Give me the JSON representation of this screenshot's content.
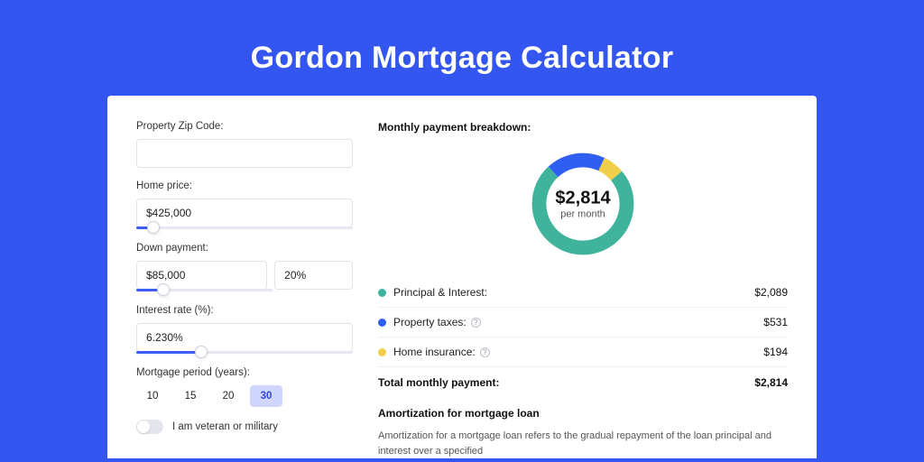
{
  "title": "Gordon Mortgage Calculator",
  "left": {
    "zip_label": "Property Zip Code:",
    "zip_value": "",
    "home_price_label": "Home price:",
    "home_price_value": "$425,000",
    "home_price_slider_pct": 8,
    "down_payment_label": "Down payment:",
    "down_payment_value": "$85,000",
    "down_payment_pct_value": "20%",
    "down_payment_slider_pct": 20,
    "interest_label": "Interest rate (%):",
    "interest_value": "6.230%",
    "interest_slider_pct": 30,
    "period_label": "Mortgage period (years):",
    "period_options": [
      "10",
      "15",
      "20",
      "30"
    ],
    "period_selected": "30",
    "veteran_label": "I am veteran or military",
    "veteran_on": false
  },
  "right": {
    "breakdown_title": "Monthly payment breakdown:",
    "donut_amount": "$2,814",
    "donut_sub": "per month",
    "legend": [
      {
        "label": "Principal & Interest:",
        "value": "$2,089",
        "color": "#3fb39b",
        "info": false
      },
      {
        "label": "Property taxes:",
        "value": "$531",
        "color": "#2f5ff1",
        "info": true
      },
      {
        "label": "Home insurance:",
        "value": "$194",
        "color": "#f2cf4a",
        "info": true
      }
    ],
    "total_label": "Total monthly payment:",
    "total_value": "$2,814",
    "amort_title": "Amortization for mortgage loan",
    "amort_body": "Amortization for a mortgage loan refers to the gradual repayment of the loan principal and interest over a specified"
  },
  "chart_data": {
    "type": "pie",
    "title": "Monthly payment breakdown",
    "series": [
      {
        "name": "Principal & Interest",
        "value": 2089,
        "color": "#3fb39b"
      },
      {
        "name": "Property taxes",
        "value": 531,
        "color": "#2f5ff1"
      },
      {
        "name": "Home insurance",
        "value": 194,
        "color": "#f2cf4a"
      }
    ],
    "total": 2814,
    "center_label": "$2,814",
    "center_sub": "per month"
  }
}
